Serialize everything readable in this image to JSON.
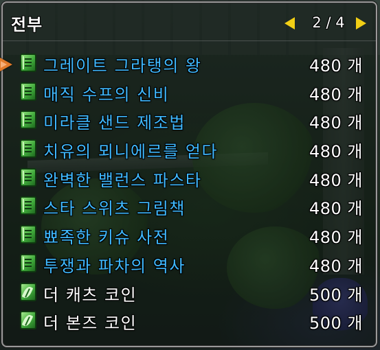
{
  "header": {
    "title": "전부",
    "page_current": "2",
    "page_total": "4",
    "page_label": "2 / 4"
  },
  "colors": {
    "recipe_name": "#3fb9ff",
    "coin_name": "#ffffff",
    "arrow": "#f2cf15",
    "cursor": "#e07a2a"
  },
  "items": [
    {
      "name": "그레이트 그라탱의 왕",
      "qty": "480 개",
      "icon": "book-icon",
      "style": "blue",
      "selected": true
    },
    {
      "name": "매직 수프의 신비",
      "qty": "480 개",
      "icon": "book-icon",
      "style": "blue"
    },
    {
      "name": "미라클 샌드 제조법",
      "qty": "480 개",
      "icon": "book-icon",
      "style": "blue"
    },
    {
      "name": "치유의 뫼니에르를 얻다",
      "qty": "480 개",
      "icon": "book-icon",
      "style": "blue"
    },
    {
      "name": "완벽한 밸런스 파스타",
      "qty": "480 개",
      "icon": "book-icon",
      "style": "blue"
    },
    {
      "name": "스타 스위츠 그림책",
      "qty": "480 개",
      "icon": "book-icon",
      "style": "blue"
    },
    {
      "name": "뾰족한 키슈 사전",
      "qty": "480 개",
      "icon": "book-icon",
      "style": "blue"
    },
    {
      "name": "투쟁과 파차의 역사",
      "qty": "480 개",
      "icon": "book-icon",
      "style": "blue"
    },
    {
      "name": "더 캐츠 코인",
      "qty": "500 개",
      "icon": "leaf-icon",
      "style": "white"
    },
    {
      "name": "더 본즈 코인",
      "qty": "500 개",
      "icon": "leaf-icon",
      "style": "white"
    }
  ]
}
